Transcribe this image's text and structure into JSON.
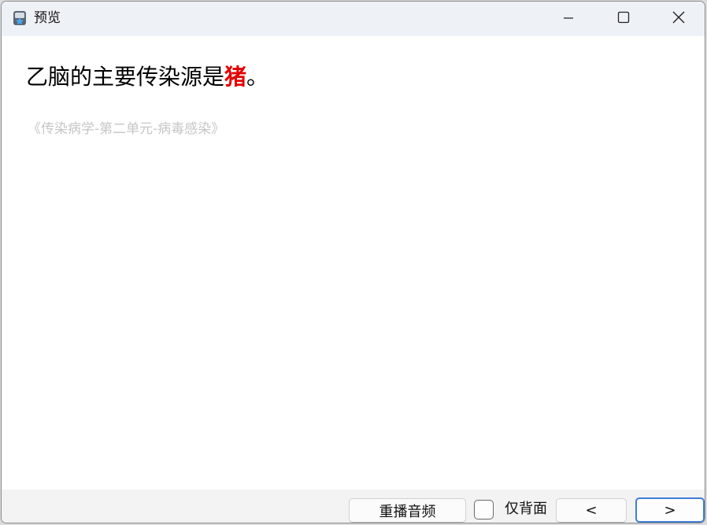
{
  "window": {
    "title": "预览",
    "icon": "star-app-icon"
  },
  "titlebar_controls": {
    "minimize_icon": "minimize-icon",
    "maximize_icon": "maximize-icon",
    "close_icon": "close-icon"
  },
  "card": {
    "question_prefix": "乙脑的主要传染源是",
    "answer": "猪",
    "question_suffix": "。",
    "answer_color": "#e50000",
    "source": "《传染病学-第二单元-病毒感染》"
  },
  "footer": {
    "replay_label": "重播音频",
    "back_only_label": "仅背面",
    "back_only_checked": false,
    "prev_label": "<",
    "next_label": ">"
  }
}
